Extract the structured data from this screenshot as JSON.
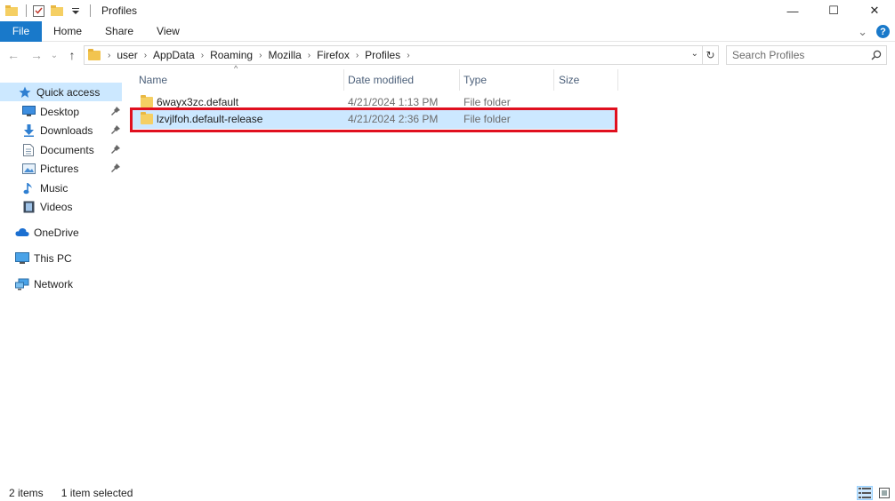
{
  "window": {
    "title": "Profiles",
    "controls": {
      "minimize": "—",
      "maximize": "☐",
      "close": "✕"
    }
  },
  "ribbon": {
    "tabs": [
      "File",
      "Home",
      "Share",
      "View"
    ],
    "expand_glyph": "⌄",
    "help_glyph": "?"
  },
  "address": {
    "back_glyph": "←",
    "forward_glyph": "→",
    "recent_glyph": "⌄",
    "up_glyph": "↑",
    "breadcrumbs": [
      "user",
      "AppData",
      "Roaming",
      "Mozilla",
      "Firefox",
      "Profiles"
    ],
    "separator": "›",
    "dropdown_glyph": "⌄",
    "refresh_glyph": "↻"
  },
  "search": {
    "placeholder": "Search Profiles"
  },
  "sidebar": {
    "items": [
      {
        "label": "Quick access",
        "icon": "star-icon",
        "active": true
      },
      {
        "label": "Desktop",
        "icon": "desktop-icon",
        "pinned": true
      },
      {
        "label": "Downloads",
        "icon": "download-icon",
        "pinned": true
      },
      {
        "label": "Documents",
        "icon": "document-icon",
        "pinned": true
      },
      {
        "label": "Pictures",
        "icon": "picture-icon",
        "pinned": true
      },
      {
        "label": "Music",
        "icon": "music-icon"
      },
      {
        "label": "Videos",
        "icon": "video-icon"
      },
      {
        "label": "OneDrive",
        "icon": "cloud-icon"
      },
      {
        "label": "This PC",
        "icon": "computer-icon"
      },
      {
        "label": "Network",
        "icon": "network-icon"
      }
    ]
  },
  "columns": {
    "name": "Name",
    "date": "Date modified",
    "type": "Type",
    "size": "Size",
    "sort_glyph": "^"
  },
  "files": [
    {
      "name": "6wayx3zc.default",
      "date": "4/21/2024 1:13 PM",
      "type": "File folder",
      "size": ""
    },
    {
      "name": "lzvjlfoh.default-release",
      "date": "4/21/2024 2:36 PM",
      "type": "File folder",
      "size": "",
      "selected": true
    }
  ],
  "status": {
    "count": "2 items",
    "selection": "1 item selected"
  },
  "colors": {
    "accent": "#1979ca",
    "selection": "#cce8ff",
    "highlight": "#e0101f",
    "folder": "#f5cf63"
  }
}
